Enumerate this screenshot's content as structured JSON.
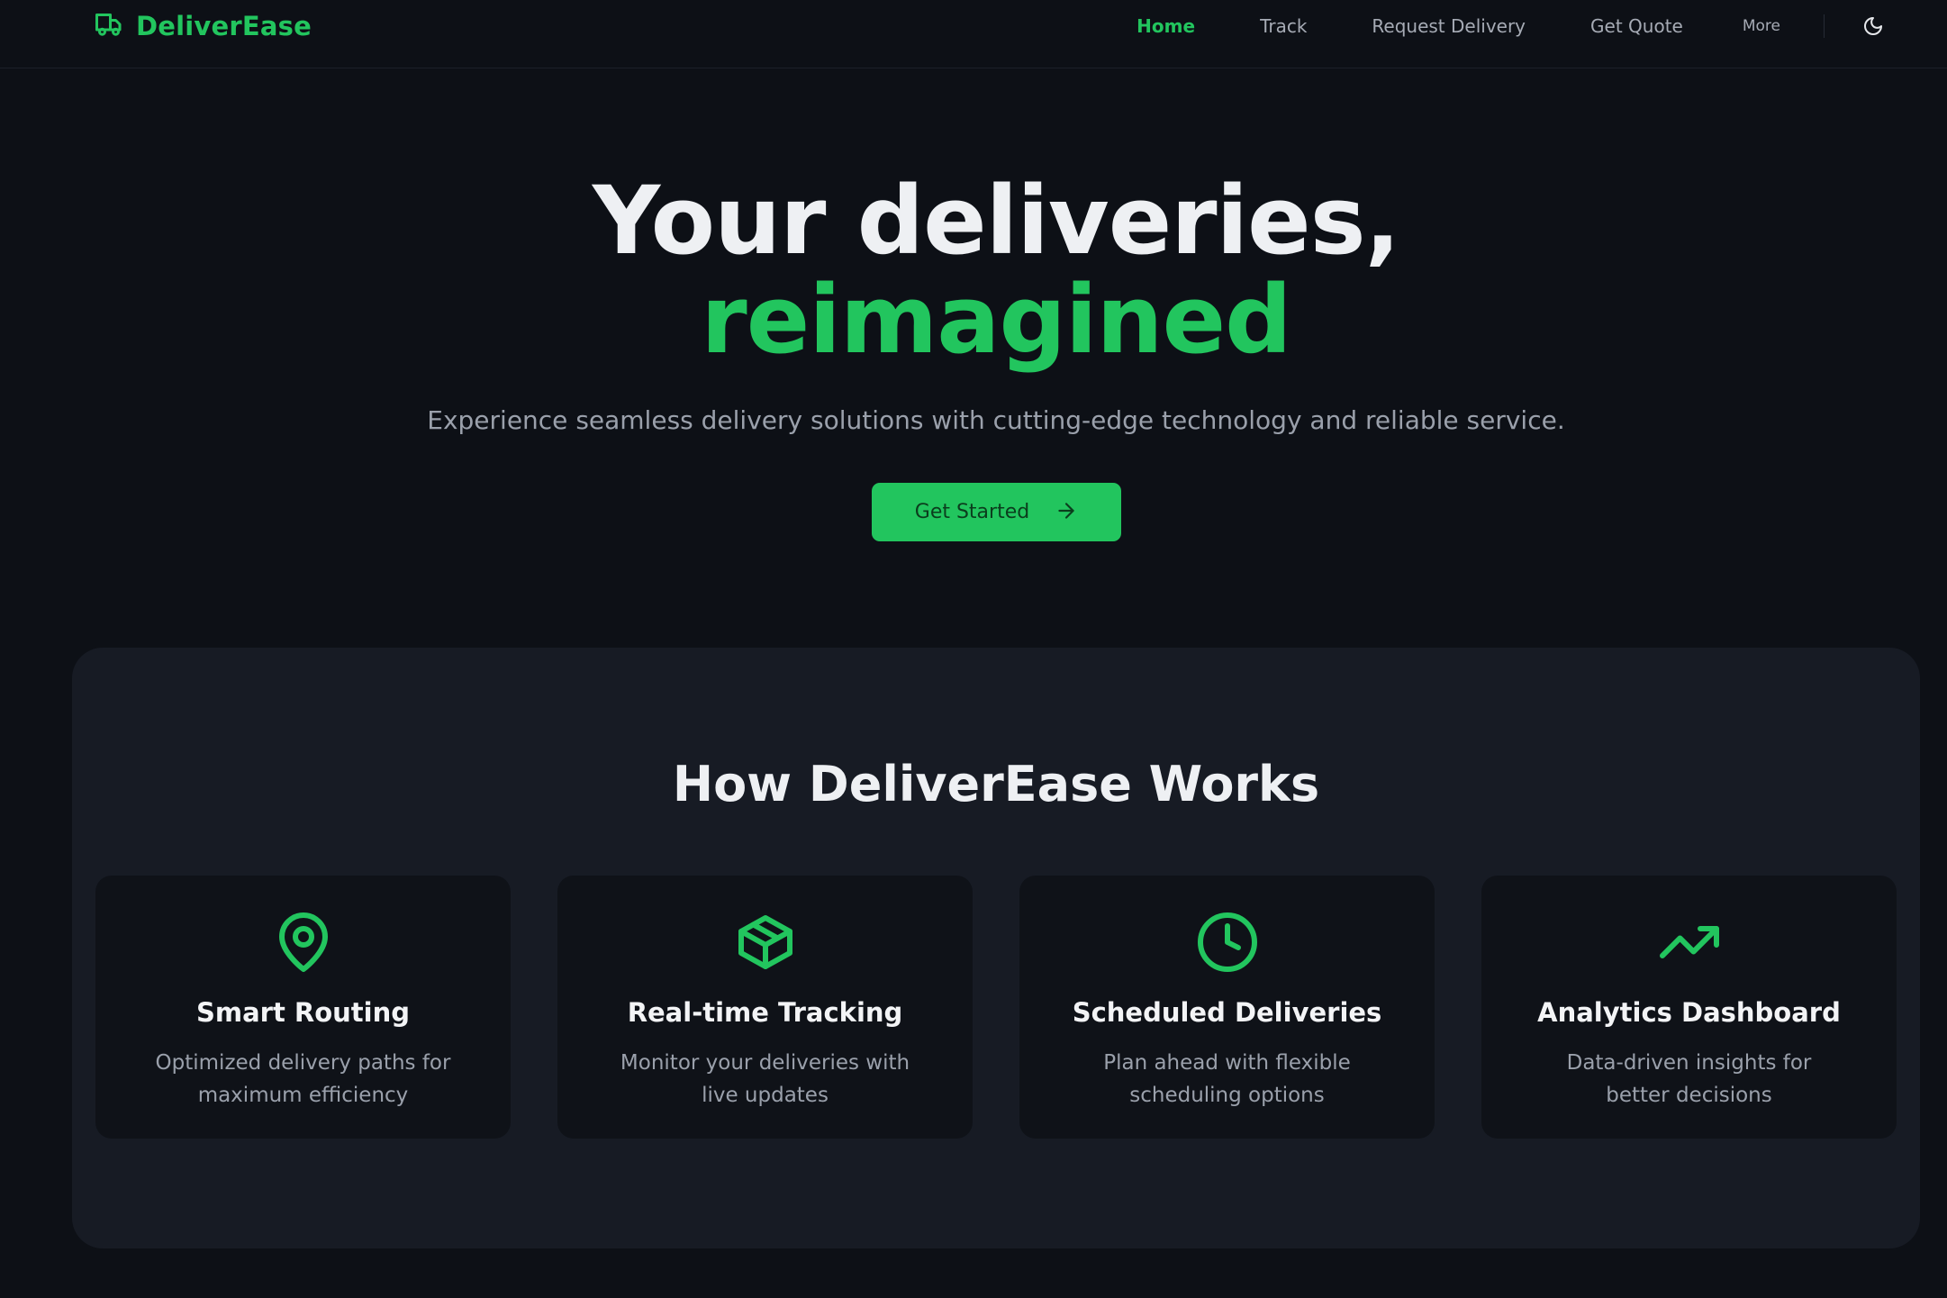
{
  "brand": {
    "name": "DeliverEase",
    "icon": "truck-icon",
    "color": "#22c55e"
  },
  "nav": {
    "items": [
      {
        "label": "Home",
        "active": true
      },
      {
        "label": "Track",
        "active": false
      },
      {
        "label": "Request Delivery",
        "active": false
      },
      {
        "label": "Get Quote",
        "active": false
      },
      {
        "label": "More",
        "active": false
      }
    ],
    "theme_toggle_icon": "moon-icon"
  },
  "hero": {
    "title_line1": "Your deliveries,",
    "title_line2": "reimagined",
    "subtitle": "Experience seamless delivery solutions with cutting-edge technology and reliable service.",
    "cta_label": "Get Started",
    "cta_icon": "arrow-right-icon"
  },
  "how_it_works": {
    "title": "How DeliverEase Works",
    "features": [
      {
        "icon": "map-pin-icon",
        "title": "Smart Routing",
        "description": "Optimized delivery paths for maximum efficiency"
      },
      {
        "icon": "package-icon",
        "title": "Real-time Tracking",
        "description": "Monitor your deliveries with live updates"
      },
      {
        "icon": "clock-icon",
        "title": "Scheduled Deliveries",
        "description": "Plan ahead with flexible scheduling options"
      },
      {
        "icon": "trending-up-icon",
        "title": "Analytics Dashboard",
        "description": "Data-driven insights for better decisions"
      }
    ]
  },
  "colors": {
    "accent": "#22c55e",
    "background": "#0d1016",
    "panel": "#171b24",
    "card": "#0f1218"
  }
}
